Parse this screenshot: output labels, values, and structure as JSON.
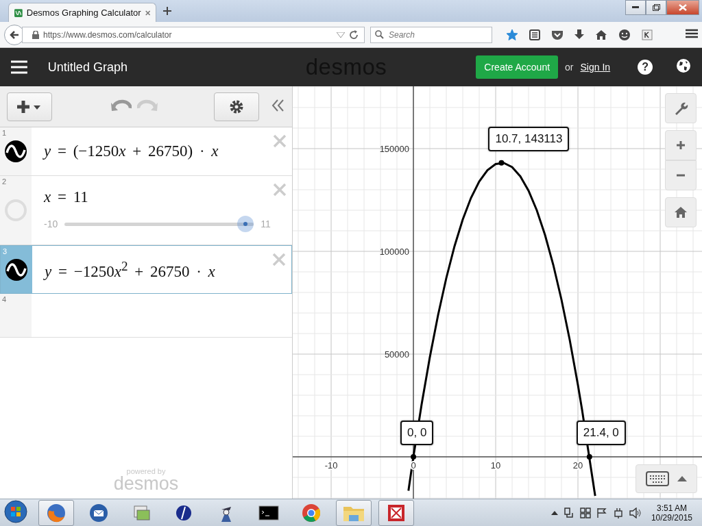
{
  "browser": {
    "tab": {
      "title": "Desmos Graphing Calculator"
    },
    "url": "https://www.desmos.com/calculator",
    "search": {
      "placeholder": "Search"
    },
    "bookmarked": true
  },
  "header": {
    "title": "Untitled Graph",
    "logo": "desmos",
    "create_account": "Create Account",
    "or": "or",
    "sign_in": "Sign In",
    "help": "?"
  },
  "expressions": [
    {
      "index": "1",
      "kind": "function",
      "selected": false,
      "latex": "y = (−1250x + 26750) · x"
    },
    {
      "index": "2",
      "kind": "slider",
      "selected": false,
      "latex": "x = 11",
      "slider": {
        "min": "-10",
        "max": "11",
        "level": 1
      }
    },
    {
      "index": "3",
      "kind": "function",
      "selected": true,
      "latex": "y = −1250x$^{2}$ + 26750 · x"
    },
    {
      "index": "4",
      "kind": "empty",
      "selected": false
    }
  ],
  "footer": {
    "powered_by": "powered by",
    "logo": "desmos"
  },
  "graph": {
    "chart_data": {
      "type": "line",
      "x": [
        -0.6,
        0,
        1,
        2,
        3,
        4,
        5,
        6,
        7,
        8,
        9,
        10,
        11,
        12,
        13,
        14,
        15,
        16,
        17,
        18,
        19,
        20,
        20.5,
        22,
        22.1
      ],
      "series": [
        {
          "color": "#000000",
          "values": [
            -16500,
            0,
            25500,
            48500,
            69000,
            87000,
            102500,
            115500,
            126000,
            134000,
            139500,
            142500,
            143000,
            141000,
            136500,
            129500,
            120000,
            108000,
            93500,
            76500,
            57000,
            35000,
            23000,
            -16500,
            -19000
          ]
        }
      ],
      "grid": true,
      "xlim": [
        -14.67,
        35.08
      ],
      "ylim": [
        -20333,
        180333
      ],
      "xticks": [
        -10,
        0,
        10,
        20
      ],
      "yticks": [
        50000,
        100000,
        150000
      ],
      "annotations": [
        {
          "x": 10.7,
          "y": 143113,
          "text": "10.7, 143113"
        },
        {
          "x": 0,
          "y": 0,
          "text": "0, 0"
        },
        {
          "x": 21.4,
          "y": 0,
          "text": "21.4, 0"
        }
      ]
    }
  },
  "taskbar": {
    "apps": [
      {
        "kind": "firefox",
        "running": true
      },
      {
        "kind": "mail",
        "running": false
      },
      {
        "kind": "photos",
        "running": false
      },
      {
        "kind": "disc",
        "running": false
      },
      {
        "kind": "person",
        "running": false
      },
      {
        "kind": "terminal",
        "running": false
      },
      {
        "kind": "chrome",
        "running": false
      },
      {
        "kind": "folder",
        "running": true
      },
      {
        "kind": "picture",
        "running": true
      }
    ],
    "time": "3:51 AM",
    "date": "10/29/2015"
  }
}
